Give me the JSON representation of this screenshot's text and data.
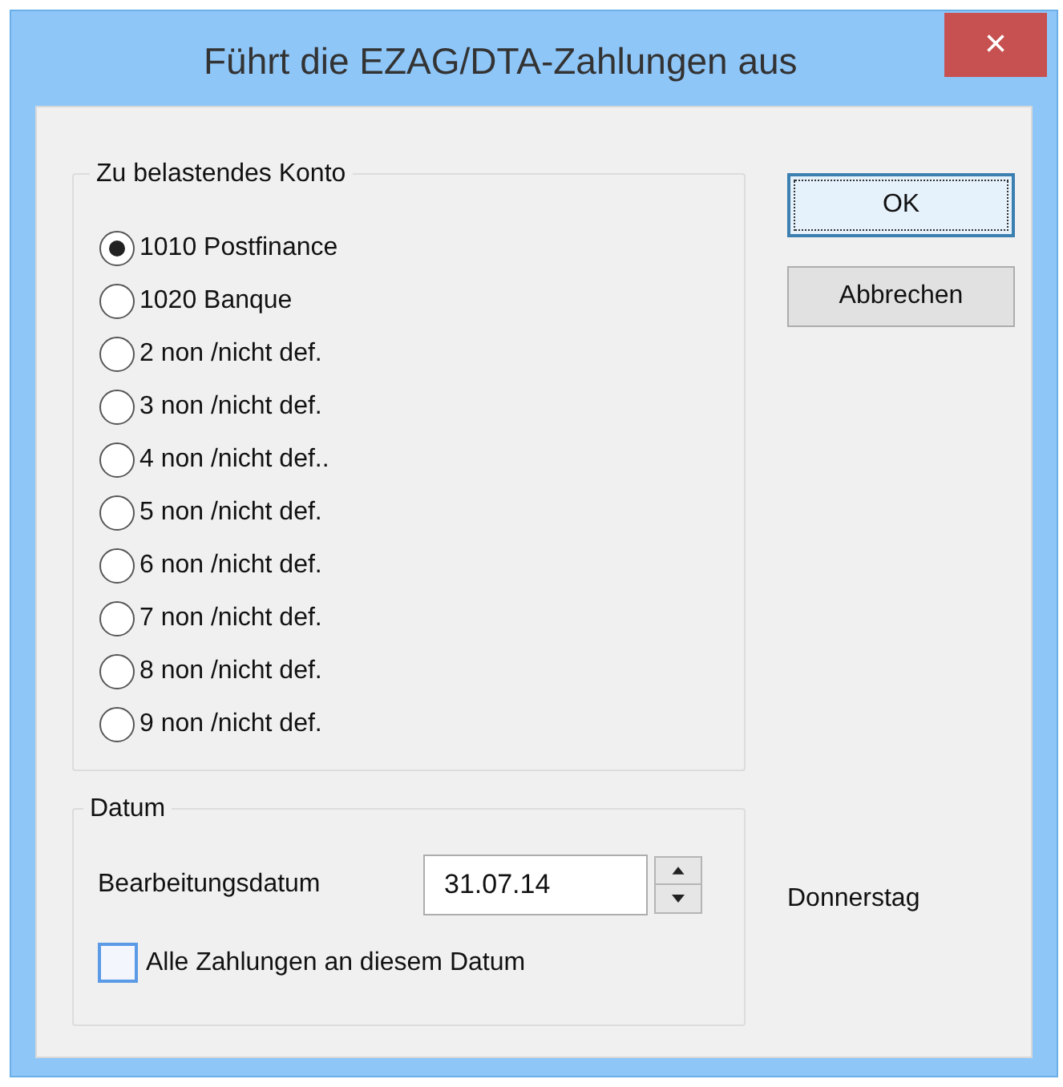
{
  "window": {
    "title": "Führt die EZAG/DTA-Zahlungen aus",
    "close": "×"
  },
  "account_group": {
    "title": "Zu belastendes Konto",
    "options": [
      {
        "label": "1010 Postfinance",
        "selected": true
      },
      {
        "label": "1020 Banque",
        "selected": false
      },
      {
        "label": "2 non /nicht def.",
        "selected": false
      },
      {
        "label": "3 non /nicht def.",
        "selected": false
      },
      {
        "label": "4 non /nicht def..",
        "selected": false
      },
      {
        "label": "5 non /nicht def.",
        "selected": false
      },
      {
        "label": "6 non /nicht def.",
        "selected": false
      },
      {
        "label": "7 non /nicht def.",
        "selected": false
      },
      {
        "label": "8 non /nicht def.",
        "selected": false
      },
      {
        "label": "9 non /nicht def.",
        "selected": false
      }
    ]
  },
  "buttons": [
    {
      "label": "OK",
      "default": true
    },
    {
      "label": "Abbrechen",
      "default": false
    }
  ],
  "date_group": {
    "title": "Datum",
    "field_label": "Bearbeitungsdatum",
    "value": "31.07.14",
    "weekday": "Donnerstag",
    "checkbox": {
      "label": "Alle Zahlungen an diesem Datum",
      "checked": false
    }
  }
}
